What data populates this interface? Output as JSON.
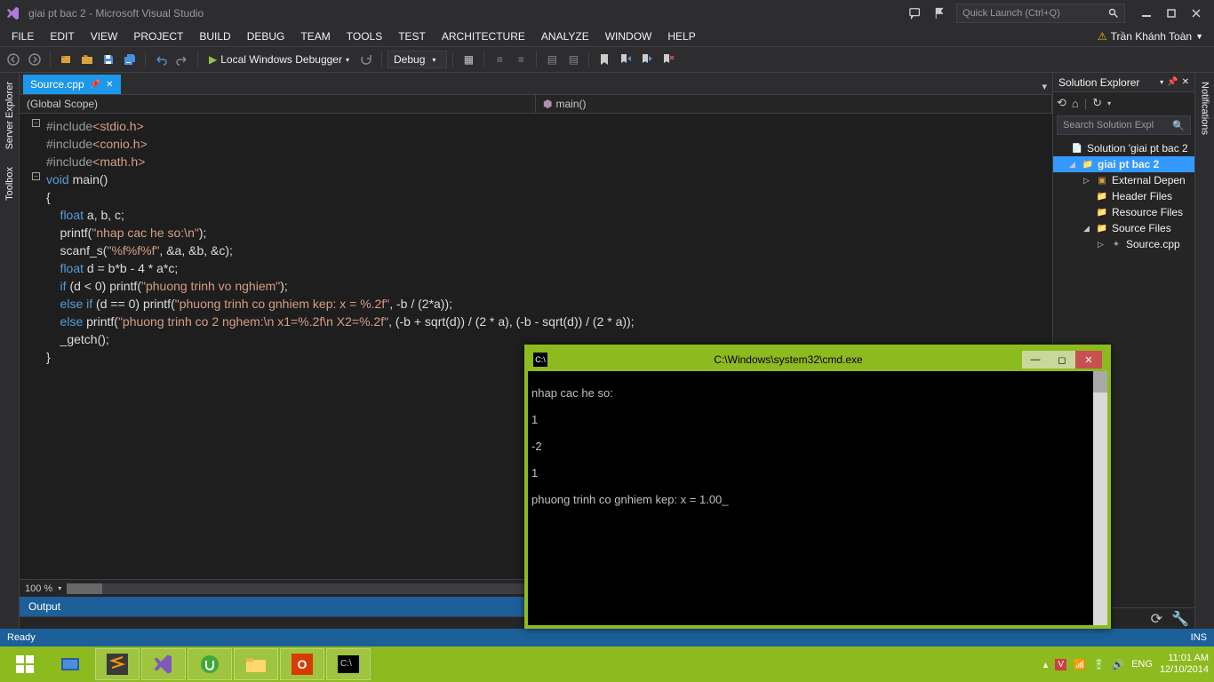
{
  "titlebar": {
    "title": "giai pt bac 2 - Microsoft Visual Studio",
    "quick_launch_placeholder": "Quick Launch (Ctrl+Q)"
  },
  "menu": [
    "FILE",
    "EDIT",
    "VIEW",
    "PROJECT",
    "BUILD",
    "DEBUG",
    "TEAM",
    "TOOLS",
    "TEST",
    "ARCHITECTURE",
    "ANALYZE",
    "WINDOW",
    "HELP"
  ],
  "user": "Trần Khánh Toàn",
  "toolbar": {
    "debugger_label": "Local Windows Debugger",
    "config_label": "Debug"
  },
  "left_tabs": [
    "Server Explorer",
    "Toolbox"
  ],
  "doc_tab": "Source.cpp",
  "navbar": {
    "scope": "(Global Scope)",
    "func": "main()"
  },
  "code": {
    "l1a": "#include",
    "l1b": "<stdio.h>",
    "l2a": "#include",
    "l2b": "<conio.h>",
    "l3a": "#include",
    "l3b": "<math.h>",
    "l4a": "void",
    "l4b": " main()",
    "l5": "{",
    "l6a": "    float",
    "l6b": " a, b, c;",
    "l7a": "    printf(",
    "l7b": "\"nhap cac he so:\\n\"",
    "l7c": ");",
    "l8a": "    scanf_s(",
    "l8b": "\"%f%f%f\"",
    "l8c": ", &a, &b, &c);",
    "l9a": "    float",
    "l9b": " d = b*b - 4 * a*c;",
    "l10a": "    if",
    "l10b": " (d < 0) printf(",
    "l10c": "\"phuong trinh vo nghiem\"",
    "l10d": ");",
    "l11a": "    else if",
    "l11b": " (d == 0) printf(",
    "l11c": "\"phuong trinh co gnhiem kep: x = %.2f\"",
    "l11d": ", -b / (2*a));",
    "l12a": "    else",
    "l12b": " printf(",
    "l12c": "\"phuong trinh co 2 nghem:\\n x1=%.2f\\n X2=%.2f\"",
    "l12d": ", (-b + sqrt(d)) / (2 * a), (-b - sqrt(d)) / (2 * a));",
    "l13": "    _getch();",
    "l14": "}"
  },
  "zoom": "100 %",
  "output_label": "Output",
  "solution_explorer": {
    "title": "Solution Explorer",
    "search_placeholder": "Search Solution Expl",
    "root": "Solution 'giai pt bac 2",
    "project": "giai pt bac 2",
    "folders": {
      "external": "External Depen",
      "headers": "Header Files",
      "resources": "Resource Files",
      "sources": "Source Files",
      "source_file": "Source.cpp"
    }
  },
  "right_tab": "Notifications",
  "status": {
    "ready": "Ready",
    "ins": "INS"
  },
  "console": {
    "title": "C:\\Windows\\system32\\cmd.exe",
    "lines": [
      "nhap cac he so:",
      "1",
      "-2",
      "1",
      "phuong trinh co gnhiem kep: x = 1.00_"
    ]
  },
  "tray": {
    "lang": "ENG",
    "time": "11:01 AM",
    "date": "12/10/2014"
  }
}
